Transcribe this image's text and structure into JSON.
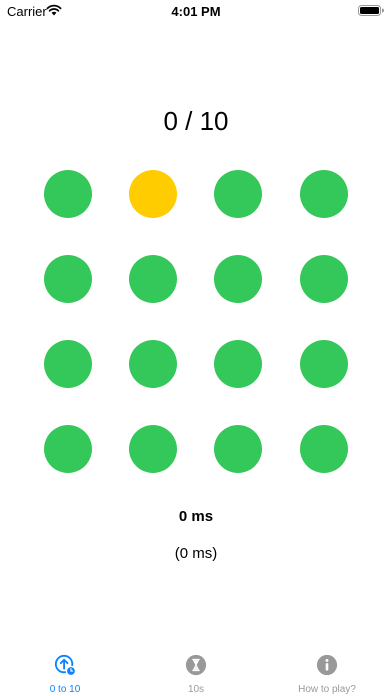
{
  "status_bar": {
    "carrier": "Carrier",
    "time": "4:01 PM"
  },
  "game": {
    "score": "0 / 10",
    "dots": [
      "green",
      "yellow",
      "green",
      "green",
      "green",
      "green",
      "green",
      "green",
      "green",
      "green",
      "green",
      "green",
      "green",
      "green",
      "green",
      "green"
    ],
    "time_main": "0 ms",
    "time_sub": "(0 ms)"
  },
  "colors": {
    "green": "#34c759",
    "yellow": "#ffcc00",
    "accent": "#0a84ff",
    "inactive": "#999999"
  },
  "tab_bar": {
    "tabs": [
      {
        "label": "0 to 10",
        "icon": "arrow-up-circle-badge-icon",
        "active": true
      },
      {
        "label": "10s",
        "icon": "hourglass-icon",
        "active": false
      },
      {
        "label": "How to play?",
        "icon": "info-icon",
        "active": false
      }
    ]
  }
}
